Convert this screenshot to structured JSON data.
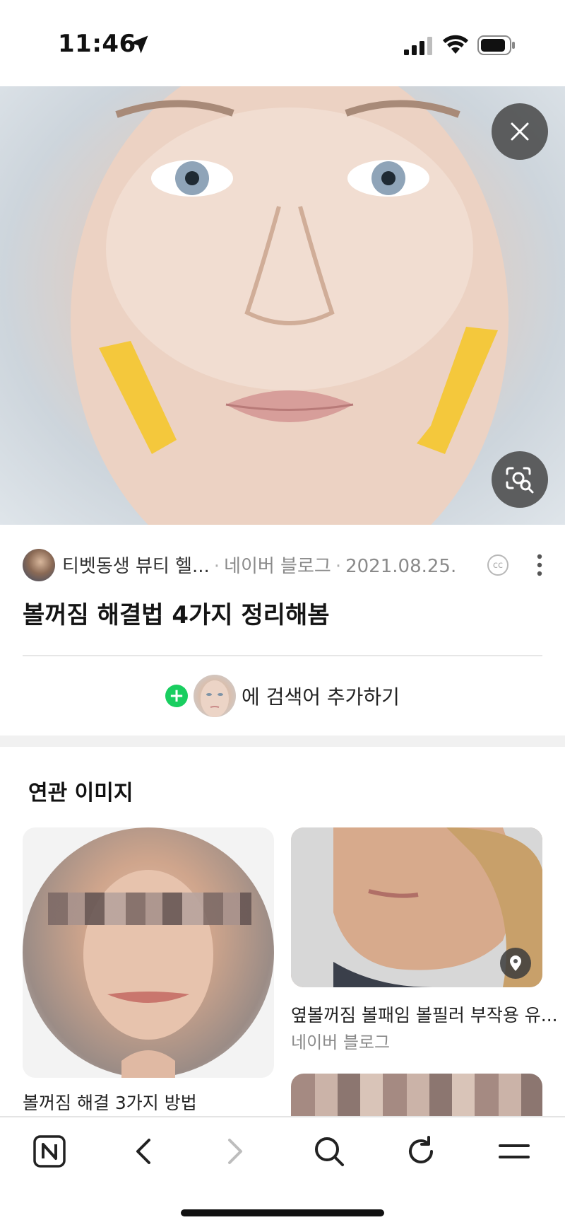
{
  "status_bar": {
    "time": "11:46"
  },
  "result": {
    "author": "티벳동생 뷰티 헬...",
    "source": "네이버 블로그",
    "date": "2021.08.25.",
    "title": "볼꺼짐 해결법 4가지 정리해봄",
    "add_search_text": "에 검색어 추가하기"
  },
  "related": {
    "section_title": "연관 이미지",
    "items": [
      {
        "caption": "볼꺼짐 해결 3가지 방법"
      },
      {
        "caption": "옆볼꺼짐 볼패임 볼필러 부작용 유...",
        "source": "네이버 블로그"
      }
    ]
  },
  "icons": {
    "close": "close-icon",
    "lens": "image-search-icon",
    "more": "more-vertical-icon",
    "add": "plus-icon",
    "location": "location-pin-icon"
  },
  "colors": {
    "accent_green": "#19ce60",
    "overlay_button": "#464646"
  }
}
